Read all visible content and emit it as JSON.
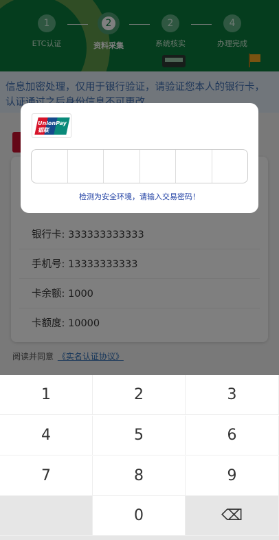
{
  "steps": [
    {
      "num": "1",
      "label": "ETC认证"
    },
    {
      "num": "2",
      "label": "资料采集"
    },
    {
      "num": "2",
      "label": "系统核实"
    },
    {
      "num": "4",
      "label": "办理完成"
    }
  ],
  "notice": "信息加密处理，仅用于银行验证，请验证您本人的银行卡，认证通过之后身份信息不可更改",
  "form": {
    "rows": [
      {
        "label": "银行卡:",
        "value": "333333333333"
      },
      {
        "label": "手机号:",
        "value": "13333333333"
      },
      {
        "label": "卡余额:",
        "value": "1000"
      },
      {
        "label": "卡额度:",
        "value": "10000"
      }
    ]
  },
  "agree": {
    "text": "阅读并同意",
    "link": "《实名认证协议》"
  },
  "dialog": {
    "logo_text": "UnionPay 银联",
    "hint": "检测为安全环境，请输入交易密码！"
  },
  "keypad": {
    "keys": [
      "1",
      "2",
      "3",
      "4",
      "5",
      "6",
      "7",
      "8",
      "9",
      "",
      "0",
      "⌫"
    ]
  },
  "colors": {
    "header": "#0a7a3c",
    "notice_text": "#3f6fb2",
    "hint": "#1f3fa3"
  }
}
